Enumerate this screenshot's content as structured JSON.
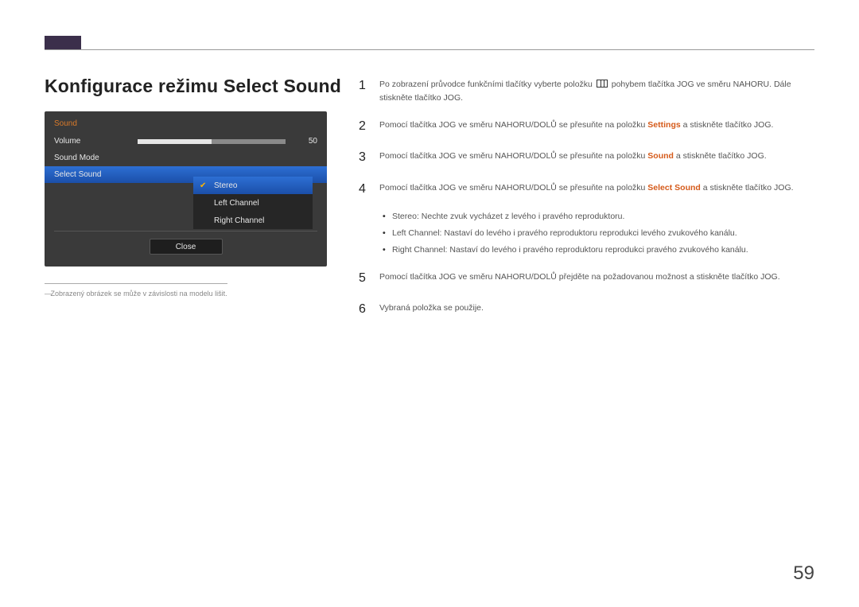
{
  "heading": "Konfigurace režimu Select Sound",
  "osd": {
    "title": "Sound",
    "rows": {
      "volume_label": "Volume",
      "volume_value": "50",
      "sound_mode": "Sound Mode",
      "select_sound": "Select Sound"
    },
    "submenu": {
      "stereo": "Stereo",
      "left": "Left Channel",
      "right": "Right Channel"
    },
    "close": "Close"
  },
  "footnote": "Zobrazený obrázek se může v závislosti na modelu lišit.",
  "steps": {
    "s1a": "Po zobrazení průvodce funkčními tlačítky vyberte položku ",
    "s1b": " pohybem tlačítka JOG ve směru NAHORU. Dále stiskněte tlačítko JOG.",
    "s2a": "Pomocí tlačítka JOG ve směru NAHORU/DOLŮ se přesuňte na položku ",
    "s2_hl": "Settings",
    "s2b": " a stiskněte tlačítko JOG.",
    "s3a": "Pomocí tlačítka JOG ve směru NAHORU/DOLŮ se přesuňte na položku ",
    "s3_hl": "Sound",
    "s3b": " a stiskněte tlačítko JOG.",
    "s4a": "Pomocí tlačítka JOG ve směru NAHORU/DOLŮ se přesuňte na položku ",
    "s4_hl": "Select Sound",
    "s4b": " a stiskněte tlačítko JOG.",
    "b1_hl": "Stereo",
    "b1": ": Nechte zvuk vycházet z levého i pravého reproduktoru.",
    "b2_hl": "Left Channel",
    "b2": ": Nastaví do levého i pravého reproduktoru reprodukci levého zvukového kanálu.",
    "b3_hl": "Right Channel",
    "b3": ": Nastaví do levého i pravého reproduktoru reprodukci pravého zvukového kanálu.",
    "s5": "Pomocí tlačítka JOG ve směru NAHORU/DOLŮ přejděte na požadovanou možnost a stiskněte tlačítko JOG.",
    "s6": "Vybraná položka se použije."
  },
  "nums": {
    "n1": "1",
    "n2": "2",
    "n3": "3",
    "n4": "4",
    "n5": "5",
    "n6": "6"
  },
  "page_number": "59"
}
